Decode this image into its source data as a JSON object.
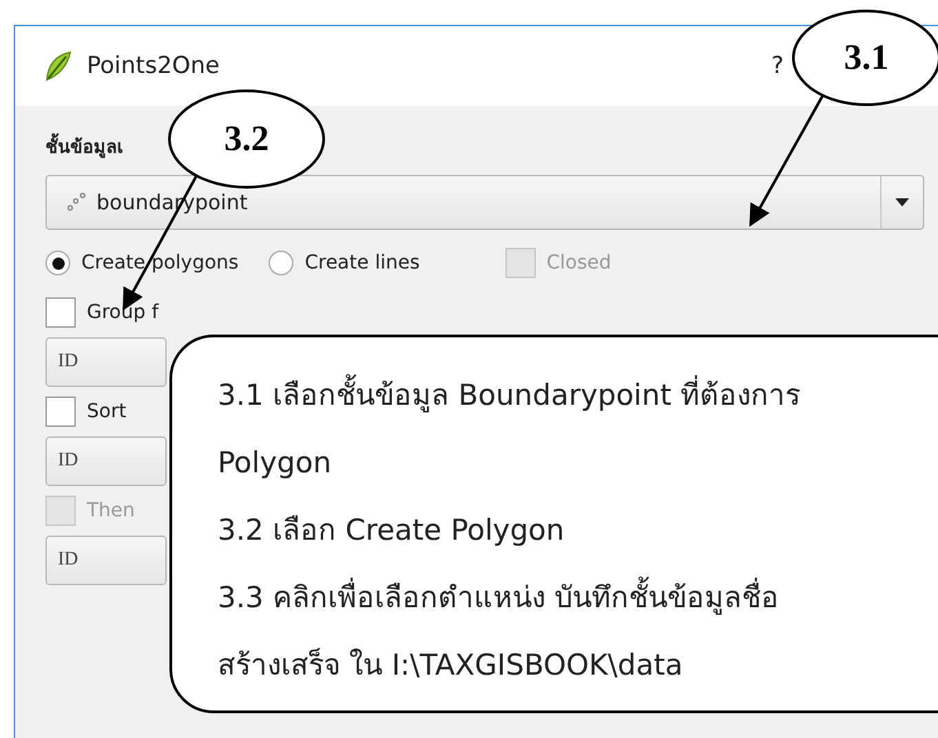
{
  "window": {
    "title": "Points2One",
    "help": "?"
  },
  "layer_label": "ชั้นข้อมูลเ",
  "layer_combo": {
    "value": "boundarypoint"
  },
  "mode_options": [
    {
      "label": "Create polygons",
      "selected": true
    },
    {
      "label": "Create lines",
      "selected": false
    }
  ],
  "closed": {
    "label": "Closed",
    "checked": false,
    "disabled": true
  },
  "options": [
    {
      "kind": "checkbox",
      "label": "Group f",
      "checked": false,
      "disabled": false
    },
    {
      "kind": "combo",
      "value": "ID"
    },
    {
      "kind": "checkbox",
      "label": "Sort",
      "checked": false,
      "disabled": false
    },
    {
      "kind": "combo",
      "value": "ID"
    },
    {
      "kind": "checkbox",
      "label": "Then",
      "checked": false,
      "disabled": true
    },
    {
      "kind": "combo",
      "value": "ID"
    }
  ],
  "callouts": [
    {
      "label": "3.1"
    },
    {
      "label": "3.2"
    }
  ],
  "note": {
    "lines": [
      "3.1 เลือกชั้นข้อมูล Boundarypoint ที่ต้องการ",
      "Polygon",
      "3.2 เลือก Create Polygon",
      "3.3 คลิกเพื่อเลือกตำแหน่ง บันทึกชั้นข้อมูลชื่อ",
      "สร้างเสร็จ ใน I:\\TAXGISBOOK\\data"
    ]
  }
}
